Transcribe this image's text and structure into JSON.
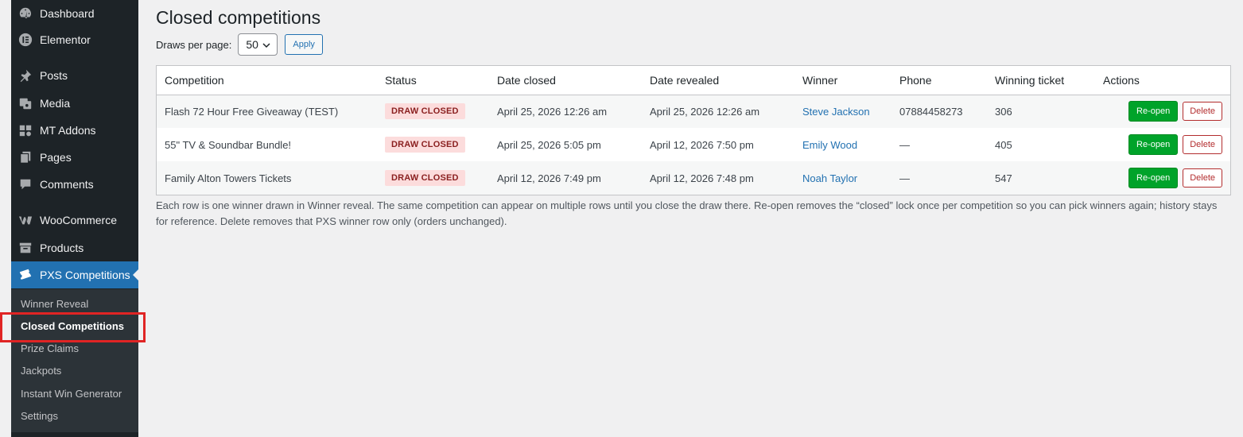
{
  "sidebar": {
    "items": [
      {
        "label": "Dashboard",
        "icon": "dashboard-icon"
      },
      {
        "label": "Elementor",
        "icon": "elementor-icon"
      },
      {
        "label": "Posts",
        "icon": "pin-icon"
      },
      {
        "label": "Media",
        "icon": "media-icon"
      },
      {
        "label": "MT Addons",
        "icon": "addons-icon"
      },
      {
        "label": "Pages",
        "icon": "pages-icon"
      },
      {
        "label": "Comments",
        "icon": "comments-icon"
      },
      {
        "label": "WooCommerce",
        "icon": "woocommerce-icon"
      },
      {
        "label": "Products",
        "icon": "products-icon"
      },
      {
        "label": "PXS Competitions",
        "icon": "ticket-icon"
      }
    ],
    "submenu": [
      {
        "label": "Winner Reveal"
      },
      {
        "label": "Closed Competitions"
      },
      {
        "label": "Prize Claims"
      },
      {
        "label": "Jackpots"
      },
      {
        "label": "Instant Win Generator"
      },
      {
        "label": "Settings"
      }
    ]
  },
  "page": {
    "title": "Closed competitions",
    "perpage_label": "Draws per page:",
    "perpage_value": "50",
    "apply_label": "Apply"
  },
  "table": {
    "columns": [
      "Competition",
      "Status",
      "Date closed",
      "Date revealed",
      "Winner",
      "Phone",
      "Winning ticket",
      "Actions"
    ],
    "rows": [
      {
        "competition": "Flash 72 Hour Free Giveaway (TEST)",
        "status": "DRAW CLOSED",
        "date_closed": "April 25, 2026 12:26 am",
        "date_revealed": "April 25, 2026 12:26 am",
        "winner": "Steve Jackson",
        "phone": "07884458273",
        "ticket": "306"
      },
      {
        "competition": "55\" TV & Soundbar Bundle!",
        "status": "DRAW CLOSED",
        "date_closed": "April 25, 2026 5:05 pm",
        "date_revealed": "April 12, 2026 7:50 pm",
        "winner": "Emily Wood",
        "phone": "—",
        "ticket": "405"
      },
      {
        "competition": "Family Alton Towers Tickets",
        "status": "DRAW CLOSED",
        "date_closed": "April 12, 2026 7:49 pm",
        "date_revealed": "April 12, 2026 7:48 pm",
        "winner": "Noah Taylor",
        "phone": "—",
        "ticket": "547"
      }
    ],
    "reopen_label": "Re-open",
    "delete_label": "Delete"
  },
  "footnote": "Each row is one winner drawn in Winner reveal. The same competition can appear on multiple rows until you close the draw there. Re-open removes the “closed” lock once per competition so you can pick winners again; history stays for reference. Delete removes that PXS winner row only (orders unchanged).",
  "colors": {
    "sidebar_bg": "#1d2327",
    "accent": "#2271b1",
    "reopen_green": "#00a32a",
    "delete_red": "#b32d2e",
    "badge_bg": "#fcdcdc"
  }
}
